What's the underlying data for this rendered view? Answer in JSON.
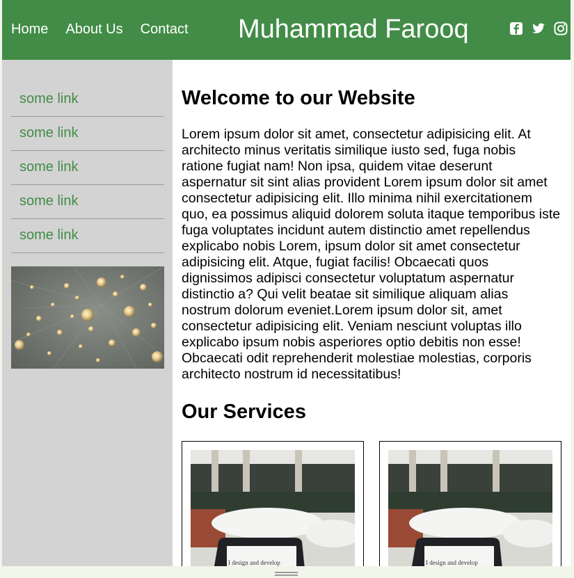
{
  "header": {
    "nav": [
      "Home",
      "About Us",
      "Contact"
    ],
    "site_title": "Muhammad Farooq",
    "social_icons": [
      "facebook-icon",
      "twitter-icon",
      "instagram-icon"
    ]
  },
  "sidebar": {
    "links": [
      "some link",
      "some link",
      "some link",
      "some link",
      "some link"
    ],
    "image": "light-bulbs-photo"
  },
  "main": {
    "heading": "Welcome to our Website",
    "paragraph": "Lorem ipsum dolor sit amet, consectetur adipisicing elit. At architecto minus veritatis similique iusto sed, fuga nobis ratione fugiat nam! Non ipsa, quidem vitae deserunt aspernatur sit sint alias provident Lorem ipsum dolor sit amet consectetur adipisicing elit. Illo minima nihil exercitationem quo, ea possimus aliquid dolorem soluta itaque temporibus iste fuga voluptates incidunt autem distinctio amet repellendus explicabo nobis Lorem, ipsum dolor sit amet consectetur adipisicing elit. Atque, fugiat facilis! Obcaecati quos dignissimos adipisci consectetur voluptatum aspernatur distinctio a? Qui velit beatae sit similique aliquam alias nostrum dolorum eveniet.Lorem ipsum dolor sit, amet consectetur adipisicing elit. Veniam nesciunt voluptas illo explicabo ipsum nobis asperiores optio debitis non esse! Obcaecati odit reprehenderit molestiae molestias, corporis architecto nostrum id necessitatibus!",
    "services_heading": "Our Services",
    "service_cards": [
      {
        "image": "laptop-photo",
        "screen_text": "I design and develop"
      },
      {
        "image": "laptop-photo",
        "screen_text": "I design and develop"
      }
    ]
  },
  "colors": {
    "header_bg": "#428c47",
    "link_green": "#428c47",
    "sidebar_bg": "#d3d3d3"
  }
}
